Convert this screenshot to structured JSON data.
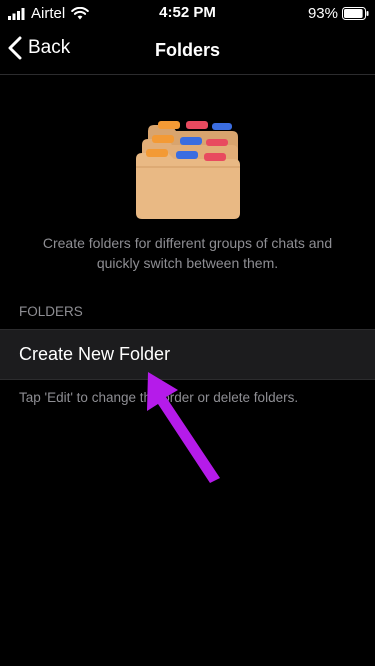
{
  "status_bar": {
    "carrier": "Airtel",
    "time": "4:52 PM",
    "battery": "93%",
    "battery_level": 0.93
  },
  "nav": {
    "back_label": "Back",
    "title": "Folders"
  },
  "main": {
    "description": "Create folders for different groups of chats and quickly switch between them.",
    "section_header": "FOLDERS",
    "create_folder_label": "Create New Folder",
    "footer_note": "Tap 'Edit' to change the order or delete folders."
  },
  "icons": {
    "signal": "signal-bars-icon",
    "wifi": "wifi-icon",
    "battery": "battery-icon",
    "back": "chevron-left-icon",
    "illustration": "folders-illustration-icon",
    "annotation": "arrow-pointer-icon"
  },
  "colors": {
    "background": "#000000",
    "row_background": "#1c1c1e",
    "secondary_text": "#8e8e93",
    "folder_tan": "#e8b985",
    "arrow_purple": "#b51bea"
  }
}
